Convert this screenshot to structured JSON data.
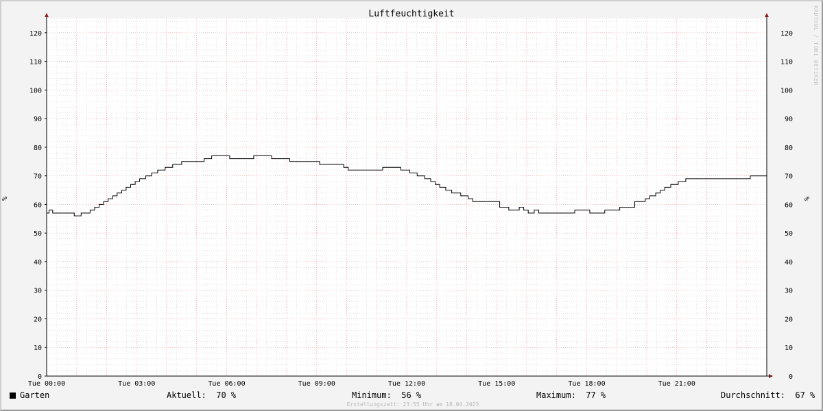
{
  "chart_data": {
    "type": "line",
    "title": "Luftfeuchtigkeit",
    "ylabel": "%",
    "y2label": "%",
    "ylim": [
      0,
      125
    ],
    "yticks": [
      0,
      10,
      20,
      30,
      40,
      50,
      60,
      70,
      80,
      90,
      100,
      110,
      120
    ],
    "xlim_hours": [
      0,
      24
    ],
    "xticks": [
      {
        "h": 0,
        "label": "Tue 00:00"
      },
      {
        "h": 3,
        "label": "Tue 03:00"
      },
      {
        "h": 6,
        "label": "Tue 06:00"
      },
      {
        "h": 9,
        "label": "Tue 09:00"
      },
      {
        "h": 12,
        "label": "Tue 12:00"
      },
      {
        "h": 15,
        "label": "Tue 15:00"
      },
      {
        "h": 18,
        "label": "Tue 18:00"
      },
      {
        "h": 21,
        "label": "Tue 21:00"
      }
    ],
    "grid": true,
    "series": [
      {
        "name": "Garten",
        "color": "#000000",
        "x_hours": [
          0,
          0.08,
          0.2,
          0.6,
          0.92,
          1.0,
          1.15,
          1.45,
          1.6,
          1.75,
          1.9,
          2.05,
          2.2,
          2.35,
          2.5,
          2.65,
          2.8,
          2.95,
          3.1,
          3.3,
          3.5,
          3.7,
          3.95,
          4.2,
          4.5,
          4.8,
          5.25,
          5.5,
          6.1,
          6.4,
          6.9,
          7.5,
          8.1,
          8.6,
          9.1,
          9.9,
          10.05,
          10.2,
          10.45,
          11.2,
          11.8,
          12.1,
          12.35,
          12.6,
          12.8,
          12.95,
          13.1,
          13.3,
          13.5,
          13.8,
          14.05,
          14.2,
          14.5,
          15.1,
          15.4,
          15.75,
          15.9,
          16.05,
          16.25,
          16.4,
          16.65,
          17.6,
          18.1,
          18.6,
          19.1,
          19.6,
          19.95,
          20.1,
          20.3,
          20.45,
          20.6,
          20.8,
          21.05,
          21.3,
          21.65,
          21.95,
          22.2,
          22.4,
          23.45,
          23.85
        ],
        "values": [
          57,
          58,
          57,
          57,
          56,
          56,
          57,
          58,
          59,
          60,
          61,
          62,
          63,
          64,
          65,
          66,
          67,
          68,
          69,
          70,
          71,
          72,
          73,
          74,
          75,
          75,
          76,
          77,
          76,
          76,
          77,
          76,
          75,
          75,
          74,
          73,
          72,
          72,
          72,
          73,
          72,
          71,
          70,
          69,
          68,
          67,
          66,
          65,
          64,
          63,
          62,
          61,
          61,
          59,
          58,
          59,
          58,
          57,
          58,
          57,
          57,
          58,
          57,
          58,
          59,
          61,
          62,
          63,
          64,
          65,
          66,
          67,
          68,
          69,
          69,
          69,
          69,
          69,
          70,
          70
        ]
      }
    ]
  },
  "legend": {
    "series_name": "Garten",
    "aktuell_label": "Aktuell:",
    "aktuell_value": "70 %",
    "minimum_label": "Minimum:",
    "minimum_value": "56 %",
    "maximum_label": "Maximum:",
    "maximum_value": "77 %",
    "durchschnitt_label": "Durchschnitt:",
    "durchschnitt_value": "67 %"
  },
  "footer": "Erstellungszeit: 23:55 Uhr am 18.04.2023",
  "watermark": "RRDTOOL / TOBI OETIKER"
}
